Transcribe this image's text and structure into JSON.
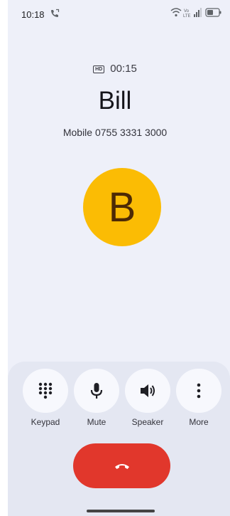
{
  "status_bar": {
    "time": "10:18"
  },
  "call": {
    "hd_label": "HD",
    "duration": "00:15",
    "caller_name": "Bill",
    "caller_number": "Mobile 0755 3331 3000",
    "avatar_letter": "B",
    "avatar_color": "#fbbc04"
  },
  "controls": [
    {
      "label": "Keypad",
      "icon": "dialpad-icon"
    },
    {
      "label": "Mute",
      "icon": "microphone-icon"
    },
    {
      "label": "Speaker",
      "icon": "speaker-icon"
    },
    {
      "label": "More",
      "icon": "more-vert-icon"
    }
  ],
  "end_call": {
    "icon": "call-end-icon",
    "color": "#e1372c"
  }
}
